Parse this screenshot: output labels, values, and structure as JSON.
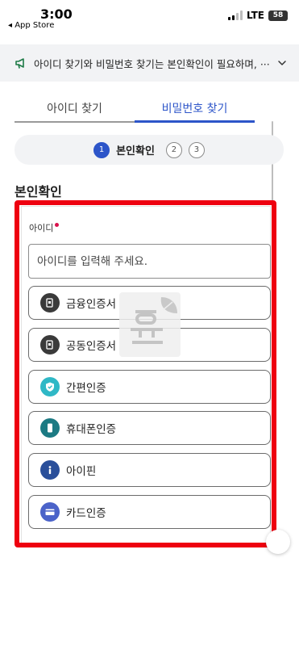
{
  "status_bar": {
    "time": "3:00",
    "back_label": "◂ App Store",
    "network": "LTE",
    "battery": "58"
  },
  "notice": {
    "text": "아이디 찾기와 비밀번호 찾기는 본인확인이 필요하며, ···"
  },
  "tabs": [
    {
      "label": "아이디 찾기",
      "active": false
    },
    {
      "label": "비밀번호 찾기",
      "active": true
    }
  ],
  "stepper": {
    "steps": [
      "1",
      "2",
      "3"
    ],
    "current_label": "본인확인"
  },
  "section_title": "본인확인",
  "id_field": {
    "label": "아이디",
    "placeholder": "아이디를 입력해 주세요."
  },
  "auth_methods": [
    {
      "label": "금융인증서",
      "icon": "financial-certificate-icon",
      "color": "#3a3a3a"
    },
    {
      "label": "공동인증서",
      "icon": "joint-certificate-icon",
      "color": "#3a3a3a"
    },
    {
      "label": "간편인증",
      "icon": "simple-auth-shield-icon",
      "color": "#2fb8c6"
    },
    {
      "label": "휴대폰인증",
      "icon": "mobile-phone-icon",
      "color": "#1c7a83"
    },
    {
      "label": "아이핀",
      "icon": "ipin-info-icon",
      "color": "#2a4f9a"
    },
    {
      "label": "카드인증",
      "icon": "credit-card-icon",
      "color": "#4b63c9"
    }
  ],
  "colors": {
    "accent": "#2d55c9",
    "highlight": "#ee0010",
    "required": "#d9124c"
  }
}
